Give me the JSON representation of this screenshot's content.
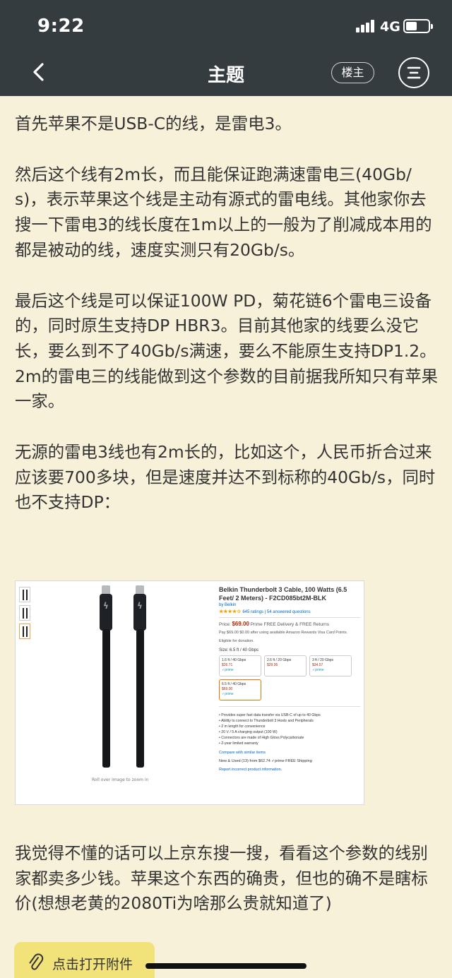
{
  "status_bar": {
    "time": "9:22",
    "network": "4G"
  },
  "nav": {
    "title": "主题",
    "author_button": "楼主",
    "back_icon": "chevron-left-icon",
    "menu_icon": "menu-icon"
  },
  "post": {
    "paragraphs": [
      "首先苹果不是USB-C的线，是雷电3。",
      "然后这个线有2m长，而且能保证跑满速雷电三(40Gb/s)，表示苹果这个线是主动有源式的雷电线。其他家你去搜一下雷电3的线长度在1m以上的一般为了削减成本用的都是被动的线，速度实测只有20Gb/s。",
      "最后这个线是可以保证100W PD，菊花链6个雷电三设备的，同时原生支持DP HBR3。目前其他家的线要么没它长，要么到不了40Gb/s满速，要么不能原生支持DP1.2。2m的雷电三的线能做到这个参数的目前据我所知只有苹果一家。",
      "无源的雷电3线也有2m长的，比如这个，人民币折合过来应该要700多块，但是速度并达不到标称的40Gb/s，同时也不支持DP：",
      "我觉得不懂的话可以上京东搜一搜，看看这个参数的线别家都卖多少钱。苹果这个东西的确贵，但也的确不是瞎标价(想想老黄的2080Ti为啥那么贵就知道了)"
    ]
  },
  "embedded_image": {
    "title": "Belkin Thunderbolt 3 Cable, 100 Watts (6.5 Feet/ 2 Meters) - F2CD085bt2M-BLK",
    "brand": "by Belkin",
    "stars": "★★★★☆",
    "ratings": "645 ratings | 54 answered questions",
    "price_label": "Price:",
    "price": "$69.00",
    "shipping": "Prime FREE Delivery & FREE Returns",
    "promo": "Pay $69.00 $0.00 after using available Amazon Rewards Visa Card Points.",
    "eligible": "Eligible for donation.",
    "size_label": "Size: 6.5 ft / 40 Gbps",
    "options": [
      {
        "name": "1.6 ft / 40 Gbps",
        "price": "$26.71",
        "prime": "✓prime"
      },
      {
        "name": "2.6 ft / 20 Gbps",
        "price": "$29.95",
        "prime": ""
      },
      {
        "name": "3 ft / 20 Gbps",
        "price": "$34.57",
        "prime": "✓prime"
      },
      {
        "name": "6.5 ft / 40 Gbps",
        "price": "$69.00",
        "prime": "✓prime"
      }
    ],
    "bullets": [
      "• Provides super fast data transfer via USB-C of up to 40 Gbps",
      "• Ability to connect to Thunderbolt 3 Hosts and Peripherals",
      "• 2 m length for convenience",
      "• 20 V / 5 A charging output (100 W)",
      "• Connectors are made of High Gloss Polycarbonate",
      "• 2-year limited warranty"
    ],
    "compare": "Compare with similar items",
    "new_used": "New & Used (13) from $62.74 ✓prime FREE Shipping",
    "report": "Report incorrect product information.",
    "roll_over": "Roll over image to zoom in"
  },
  "attachment": {
    "label": "点击打开附件",
    "icon": "paperclip-icon"
  },
  "colors": {
    "nav_bg": "#353c40",
    "page_bg": "#f8f1d9",
    "attach_bg": "#f2e27a"
  }
}
